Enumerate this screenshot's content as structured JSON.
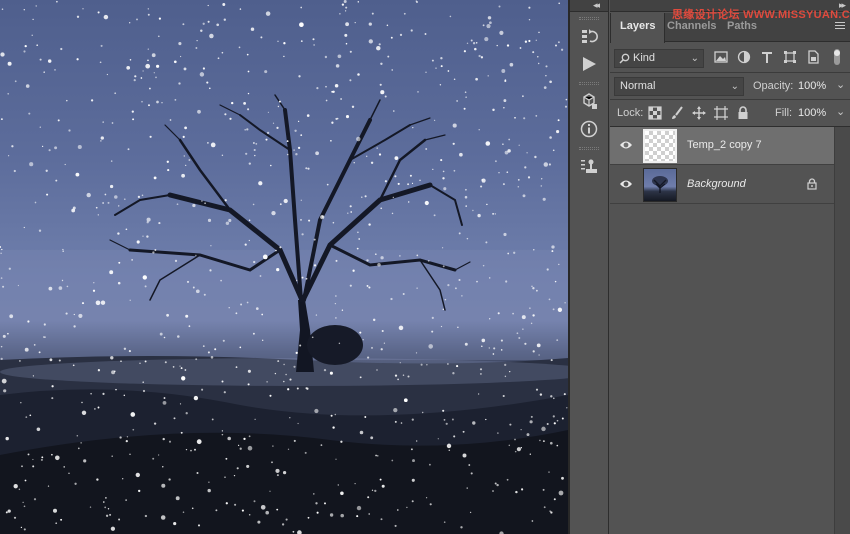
{
  "watermark": "思缘设计论坛 WWW.MISSYUAN.COM",
  "tabs": [
    {
      "label": "Layers",
      "active": true
    },
    {
      "label": "Channels",
      "active": false
    },
    {
      "label": "Paths",
      "active": false
    }
  ],
  "filter": {
    "kind_label": "Kind"
  },
  "blend": {
    "mode": "Normal",
    "opacity_label": "Opacity:",
    "opacity_value": "100%"
  },
  "lock": {
    "label": "Lock:",
    "fill_label": "Fill:",
    "fill_value": "100%"
  },
  "layers": [
    {
      "name": "Temp_2 copy 7",
      "selected": true,
      "thumbnail": "transparent-checker",
      "visible": true
    },
    {
      "name": "Background",
      "selected": false,
      "thumbnail": "tree-scene",
      "locked": true,
      "visible": true
    }
  ],
  "icons": {
    "tools": [
      "history-icon",
      "play-action-icon",
      "3d-cube-icon",
      "info-icon",
      "clone-source-icon"
    ],
    "filter": [
      "image-filter-icon",
      "adjustment-filter-icon",
      "type-filter-icon",
      "shape-filter-icon",
      "smart-object-filter-icon",
      "filter-toggle-icon"
    ],
    "lock": [
      "lock-transparent-icon",
      "lock-paint-icon",
      "lock-move-icon",
      "lock-artboard-icon",
      "lock-all-icon"
    ]
  },
  "colors": {
    "panel_bg": "#535353",
    "header_bg": "#424242",
    "selected_layer": "#6f6f6f",
    "watermark": "#e04a3d"
  }
}
